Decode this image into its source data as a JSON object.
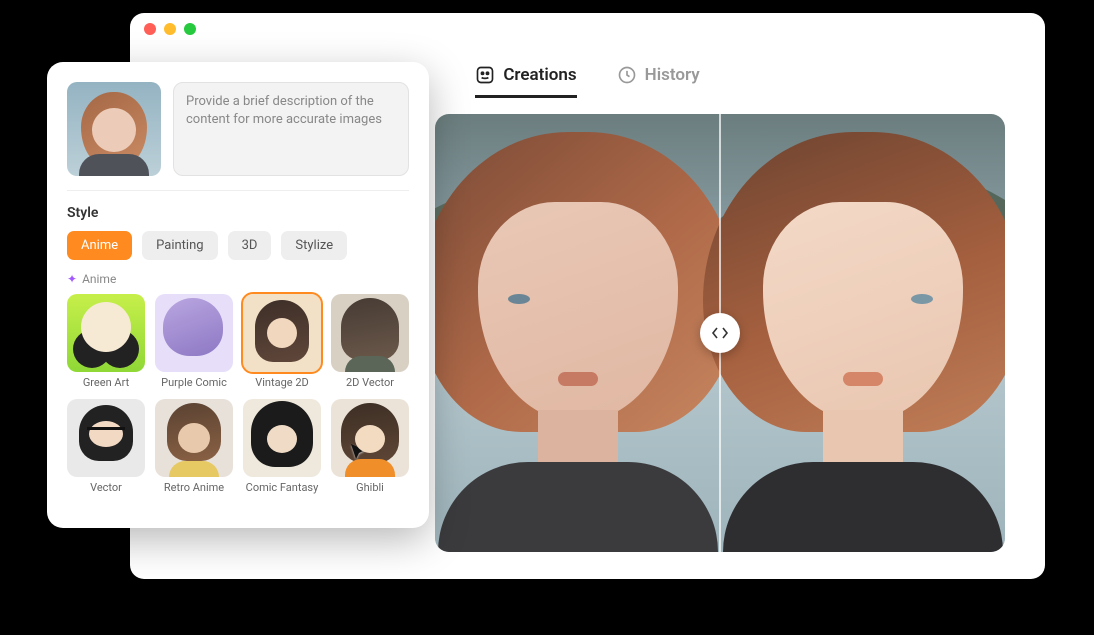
{
  "tabs": {
    "creations": "Creations",
    "history": "History"
  },
  "panel": {
    "prompt_placeholder": "Provide a brief description of the content for more accurate images",
    "style_heading": "Style",
    "style_tabs": {
      "anime": "Anime",
      "painting": "Painting",
      "threed": "3D",
      "stylize": "Stylize"
    },
    "subhead": "Anime",
    "thumbs": {
      "green": "Green Art",
      "purple": "Purple Comic",
      "vintage": "Vintage 2D",
      "vector2d": "2D Vector",
      "vector": "Vector",
      "retro": "Retro Anime",
      "comic": "Comic Fantasy",
      "ghibli": "Ghibli"
    }
  }
}
